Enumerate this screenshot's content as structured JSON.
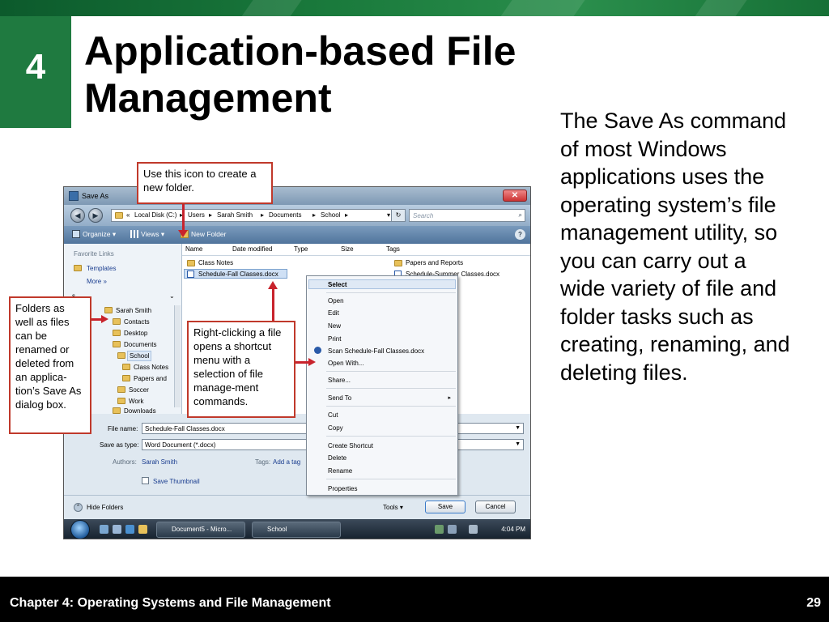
{
  "slide": {
    "chapter_number": "4",
    "title_line1": "Application-based File",
    "title_line2": "Management",
    "body": "The Save As command of most Windows applications uses the operating system’s file management utility, so you can carry out a wide variety of file and folder tasks such as creating, renaming, and deleting files.",
    "footer_text": "Chapter 4: Operating Systems and File Management",
    "page_number": "29",
    "accent_green": "#1f7a40",
    "callout_red": "#c0392b"
  },
  "callouts": {
    "new_folder": "Use this icon to create a new folder.",
    "folders": "Folders as well as files can be renamed or deleted from an applica-tion’s Save As dialog box.",
    "right_click": "Right-clicking a file opens a shortcut menu with a selection of file manage-ment commands."
  },
  "dialog": {
    "title": "Save As",
    "close_glyph": "✕",
    "address": {
      "prefix": "«",
      "segments": [
        "Local Disk (C:)",
        "Users",
        "Sarah Smith",
        "Documents",
        "School"
      ],
      "separator": "▸",
      "dropdown_glyph": "▾",
      "refresh_glyph": "↻"
    },
    "search_placeholder": "Search",
    "toolbar": {
      "organize": "Organize ▾",
      "views": "Views ▾",
      "new_folder": "New Folder",
      "help": "?"
    },
    "nav": {
      "favorite_links": "Favorite Links",
      "templates": "Templates",
      "more": "More »",
      "folders_label": "s",
      "tree": [
        "Sarah Smith",
        "Contacts",
        "Desktop",
        "Documents",
        "School",
        "Class Notes",
        "Papers and",
        "Soccer",
        "Work",
        "Downloads"
      ]
    },
    "columns": [
      "Name",
      "Date modified",
      "Type",
      "Size",
      "Tags"
    ],
    "files": {
      "col1": [
        "Class Notes",
        "Schedule-Fall Classes.docx"
      ],
      "col2": [
        "Papers and Reports",
        "Schedule-Summer Classes.docx"
      ]
    },
    "form": {
      "file_name_label": "File name:",
      "file_name_value": "Schedule-Fall Classes.docx",
      "save_as_type_label": "Save as type:",
      "save_as_type_value": "Word Document (*.docx)",
      "authors_label": "Authors:",
      "authors_value": "Sarah Smith",
      "tags_label": "Tags:",
      "tags_value": "Add a tag",
      "save_thumbnail": "Save Thumbnail"
    },
    "buttons": {
      "hide_folders": "Hide Folders",
      "tools": "Tools ▾",
      "save": "Save",
      "cancel": "Cancel"
    },
    "taskbar": {
      "task1": "Document5 - Micro...",
      "task2": "School",
      "clock": "4:04 PM"
    }
  },
  "context_menu": {
    "select": "Select",
    "open": "Open",
    "edit": "Edit",
    "new": "New",
    "print": "Print",
    "scan": "Scan Schedule-Fall Classes.docx",
    "open_with": "Open With...",
    "share": "Share...",
    "send_to": "Send To",
    "cut": "Cut",
    "copy": "Copy",
    "create_shortcut": "Create Shortcut",
    "delete": "Delete",
    "rename": "Rename",
    "properties": "Properties",
    "submenu_arrow": "▸"
  }
}
